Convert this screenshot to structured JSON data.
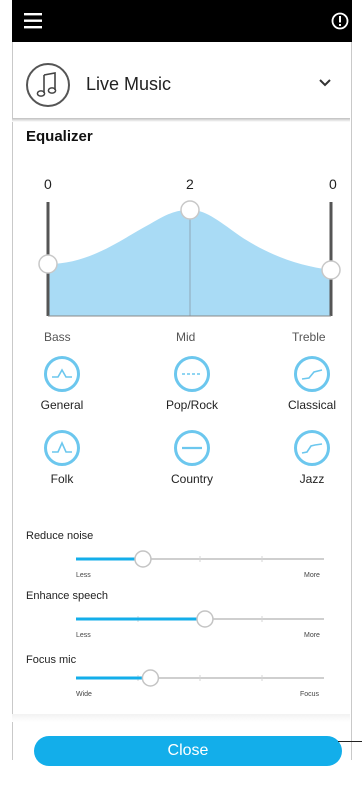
{
  "topbar": {
    "menu_icon": "hamburger-icon",
    "info_icon": "info-icon"
  },
  "program": {
    "icon": "music-note-icon",
    "title": "Live Music",
    "chevron": "chevron-down-icon"
  },
  "equalizer": {
    "title": "Equalizer",
    "values": [
      "0",
      "2",
      "0"
    ],
    "bands": [
      "Bass",
      "Mid",
      "Treble"
    ],
    "levels": {
      "bass": 0,
      "mid": 2,
      "treble": 0
    }
  },
  "presets": [
    {
      "label": "General",
      "icon": "general-eq-icon"
    },
    {
      "label": "Pop/Rock",
      "icon": "pop-rock-eq-icon"
    },
    {
      "label": "Classical",
      "icon": "classical-eq-icon"
    },
    {
      "label": "Folk",
      "icon": "folk-eq-icon"
    },
    {
      "label": "Country",
      "icon": "country-eq-icon"
    },
    {
      "label": "Jazz",
      "icon": "jazz-eq-icon"
    }
  ],
  "sliders": [
    {
      "label": "Reduce noise",
      "min_label": "Less",
      "max_label": "More",
      "value": 0.27
    },
    {
      "label": "Enhance speech",
      "min_label": "Less",
      "max_label": "More",
      "value": 0.52
    },
    {
      "label": "Focus mic",
      "min_label": "Wide",
      "max_label": "Focus",
      "value": 0.3
    }
  ],
  "close_label": "Close",
  "colors": {
    "accent": "#13aeea",
    "eq_fill": "#a9dbf5",
    "preset_ring": "#6cc7ee",
    "topbar": "#000000"
  }
}
